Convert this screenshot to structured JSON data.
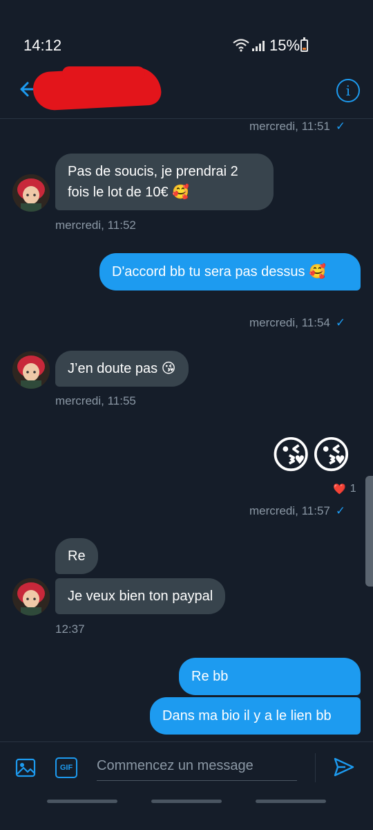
{
  "status_bar": {
    "time": "14:12",
    "battery": "15%"
  },
  "header": {
    "back_icon": "arrow-left-icon",
    "info_icon": "info-icon",
    "info_glyph": "i",
    "accent": "#1d9bf0"
  },
  "messages": [
    {
      "id": "m0",
      "direction": "out",
      "timestamp": "mercredi, 11:51",
      "read": true
    },
    {
      "id": "m1",
      "direction": "in",
      "text": "Pas de soucis, je prendrai 2 fois le lot de 10€ 🥰",
      "timestamp": "mercredi, 11:52"
    },
    {
      "id": "m2",
      "direction": "out",
      "text": "D'accord bb tu sera pas dessus 🥰",
      "timestamp": "mercredi, 11:54",
      "read": true
    },
    {
      "id": "m3",
      "direction": "in",
      "text": "J’en doute pas 😘",
      "timestamp": "mercredi, 11:55"
    },
    {
      "id": "m4",
      "direction": "out",
      "text": "😘😘",
      "timestamp": "mercredi, 11:57",
      "read": true,
      "reaction": {
        "emoji": "❤️",
        "count": "1"
      }
    },
    {
      "id": "m5",
      "direction": "in",
      "text": "Re"
    },
    {
      "id": "m6",
      "direction": "in",
      "text": "Je veux bien ton paypal",
      "timestamp": "12:37"
    },
    {
      "id": "m7",
      "direction": "out",
      "text": "Re bb"
    },
    {
      "id": "m8",
      "direction": "out",
      "text": "Dans ma bio il y a le lien bb"
    }
  ],
  "composer": {
    "placeholder": "Commencez un message",
    "image_icon": "image-icon",
    "gif_label": "GIF",
    "send_icon": "send-icon"
  },
  "colors": {
    "background": "#151d29",
    "incoming_bubble": "#38444d",
    "outgoing_bubble": "#1d9bf0",
    "timestamp": "#8b98a5",
    "redaction": "#e3151b"
  }
}
